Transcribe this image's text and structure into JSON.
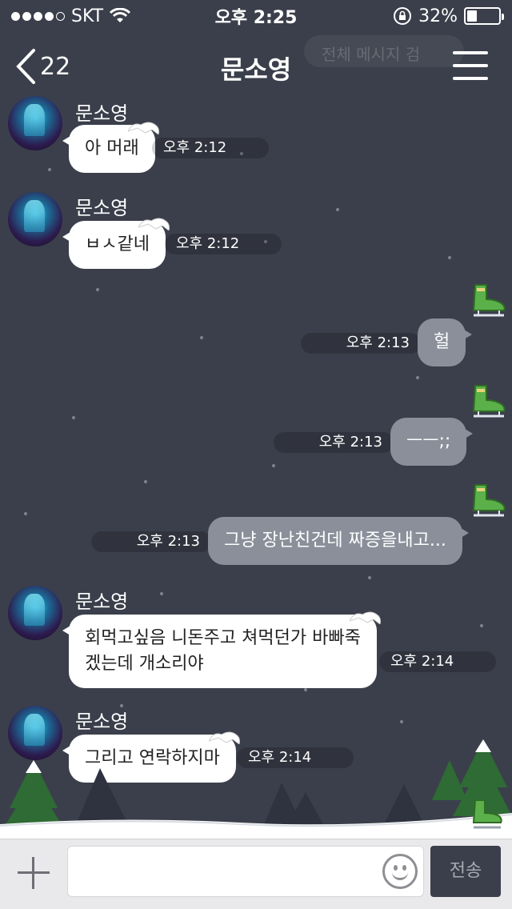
{
  "status_bar": {
    "carrier": "SKT",
    "time": "오후 2:25",
    "battery": "32%",
    "battery_level": 0.32,
    "icons": [
      "signal-dots-icon",
      "wifi-icon",
      "rotation-lock-icon",
      "battery-icon"
    ]
  },
  "nav": {
    "back_count": "22",
    "title": "문소영",
    "search_placeholder_partial": "전체 메시지 검",
    "icons": [
      "chevron-left-icon",
      "hamburger-menu-icon"
    ]
  },
  "messages": [
    {
      "direction": "in",
      "sender": "문소영",
      "text": "아 머래",
      "time": "오후 2:12"
    },
    {
      "direction": "in",
      "sender": "문소영",
      "text": "ㅂㅅ같네",
      "time": "오후 2:12"
    },
    {
      "direction": "out",
      "text": "헐",
      "time": "오후 2:13"
    },
    {
      "direction": "out",
      "text": "ㅡㅡ;;",
      "time": "오후 2:13"
    },
    {
      "direction": "out",
      "text": "그냥 장난친건데 짜증을내고...",
      "time": "오후 2:13"
    },
    {
      "direction": "in",
      "sender": "문소영",
      "text_line1": "회먹고싶음 니돈주고 쳐먹던가 바빠죽",
      "text_line2": "겠는데 개소리야",
      "time": "오후 2:14"
    },
    {
      "direction": "in",
      "sender": "문소영",
      "text": "그리고 연락하지마",
      "time": "오후 2:14"
    }
  ],
  "input_bar": {
    "placeholder": "",
    "send_label": "전송",
    "icons": [
      "plus-icon",
      "emoji-icon"
    ]
  },
  "colors": {
    "background": "#3b3f4b",
    "incoming_bubble": "#ffffff",
    "outgoing_bubble": "#8a8f9a",
    "skate_green": "#4caf50"
  }
}
